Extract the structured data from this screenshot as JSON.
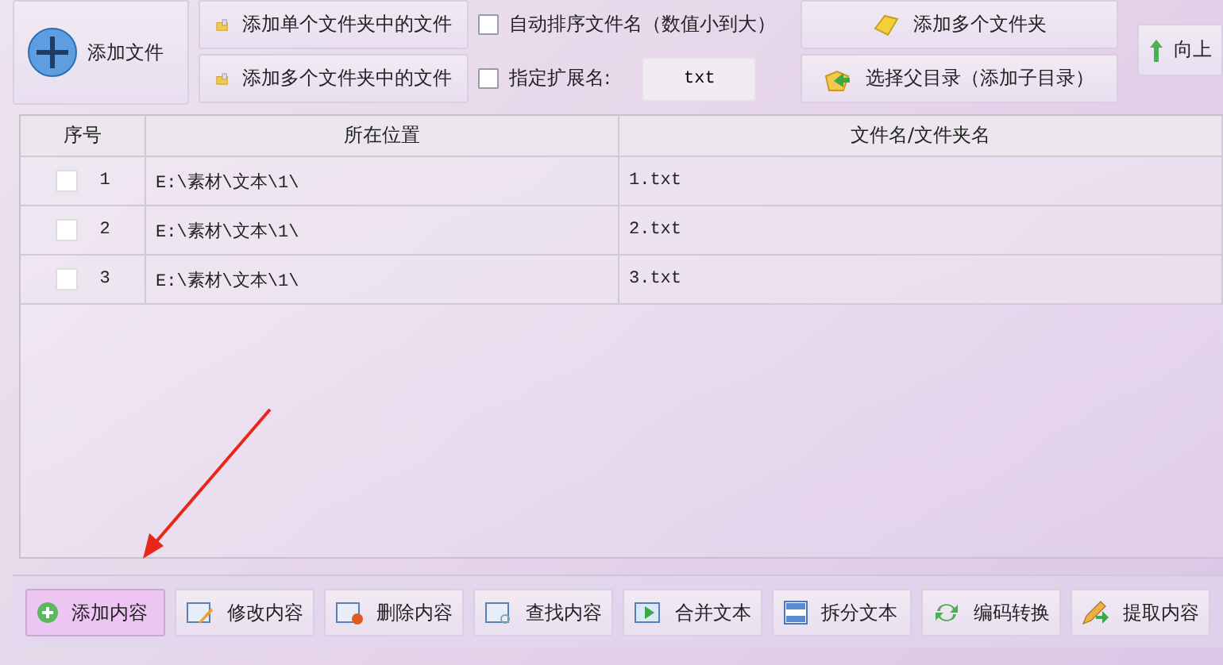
{
  "toolbar": {
    "main_button": {
      "label": "添加文件"
    },
    "file_buttons": [
      {
        "label": "添加单个文件夹中的文件"
      },
      {
        "label": "添加多个文件夹中的文件"
      }
    ],
    "options": [
      {
        "kind": "checkbox",
        "label": "自动排序文件名（数值小到大）",
        "checked": false
      },
      {
        "kind": "extension",
        "label": "指定扩展名:",
        "checked": false,
        "value": "txt"
      }
    ],
    "folder_buttons": [
      {
        "label": "添加多个文件夹"
      },
      {
        "label": "选择父目录（添加子目录）"
      }
    ],
    "up_button": {
      "label": "向上"
    }
  },
  "table": {
    "columns": [
      "序号",
      "所在位置",
      "文件名/文件夹名"
    ],
    "rows": [
      {
        "checked": false,
        "index": "1",
        "location": "E:\\素材\\文本\\1\\",
        "name": "1.txt"
      },
      {
        "checked": false,
        "index": "2",
        "location": "E:\\素材\\文本\\1\\",
        "name": "2.txt"
      },
      {
        "checked": false,
        "index": "3",
        "location": "E:\\素材\\文本\\1\\",
        "name": "3.txt"
      }
    ]
  },
  "bottom_buttons": [
    {
      "label": "添加内容",
      "selected": true
    },
    {
      "label": "修改内容",
      "selected": false
    },
    {
      "label": "删除内容",
      "selected": false
    },
    {
      "label": "查找内容",
      "selected": false
    },
    {
      "label": "合并文本",
      "selected": false
    },
    {
      "label": "拆分文本",
      "selected": false
    },
    {
      "label": "编码转换",
      "selected": false
    },
    {
      "label": "提取内容",
      "selected": false
    }
  ]
}
